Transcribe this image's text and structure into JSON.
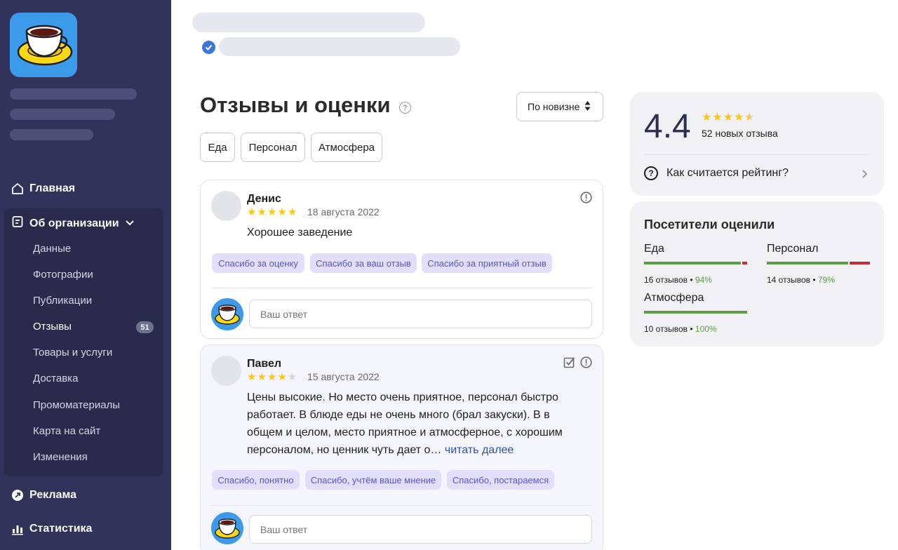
{
  "sidebar": {
    "nav": {
      "home": "Главная",
      "org": "Об организации",
      "ads": "Реклама",
      "stats": "Статистика"
    },
    "sub_items": [
      {
        "label": "Данные"
      },
      {
        "label": "Фотографии"
      },
      {
        "label": "Публикации"
      },
      {
        "label": "Отзывы",
        "active": true
      },
      {
        "label": "Товары и услуги"
      },
      {
        "label": "Доставка"
      },
      {
        "label": "Промоматериалы"
      },
      {
        "label": "Карта на сайт"
      },
      {
        "label": "Изменения"
      }
    ],
    "reviews_badge": "51"
  },
  "main": {
    "title": "Отзывы и оценки",
    "sort": {
      "label": "По новизне"
    },
    "filters": [
      "Еда",
      "Персонал",
      "Атмосфера"
    ],
    "reviews": [
      {
        "author": "Денис",
        "rating": 5,
        "date": "18 августа 2022",
        "text": "Хорошее заведение",
        "quick_replies": [
          "Спасибо за оценку",
          "Спасибо за ваш отзыв",
          "Спасибо за приятный отзыв"
        ],
        "reply_placeholder": "Ваш ответ"
      },
      {
        "author": "Павел",
        "rating": 4,
        "date": "15 августа 2022",
        "text": "Цены высокие. Но место очень приятное, персонал быстро работает. В блюде еды не очень много (брал закуски). В в общем и целом, место приятное и атмосферное, с хорошим персоналом, но ценник чуть дает о…",
        "more_link": "читать далее",
        "quick_replies": [
          "Спасибо, понятно",
          "Спасибо, учтём ваше мнение",
          "Спасибо, постараемся"
        ],
        "reply_placeholder": "Ваш ответ"
      }
    ]
  },
  "rating_summary": {
    "value": "4.4",
    "stars": 4.5,
    "new_reviews": "52 новых отзыва",
    "how_link": "Как считается рейтинг?"
  },
  "visitors": {
    "title": "Посетители оценили",
    "categories": [
      {
        "name": "Еда",
        "reviews": "16 отзывов",
        "percent": "94%",
        "positive_share": 0.94
      },
      {
        "name": "Персонал",
        "reviews": "14 отзывов",
        "percent": "79%",
        "positive_share": 0.79
      },
      {
        "name": "Атмосфера",
        "reviews": "10 отзывов",
        "percent": "100%",
        "positive_share": 1.0
      }
    ]
  },
  "colors": {
    "sidebar_bg": "#32335a",
    "star": "#fdc70f",
    "positive": "#5c9d45",
    "negative": "#c72d39",
    "quick_reply_bg": "#e1dffc",
    "link": "#2b4fb5"
  }
}
